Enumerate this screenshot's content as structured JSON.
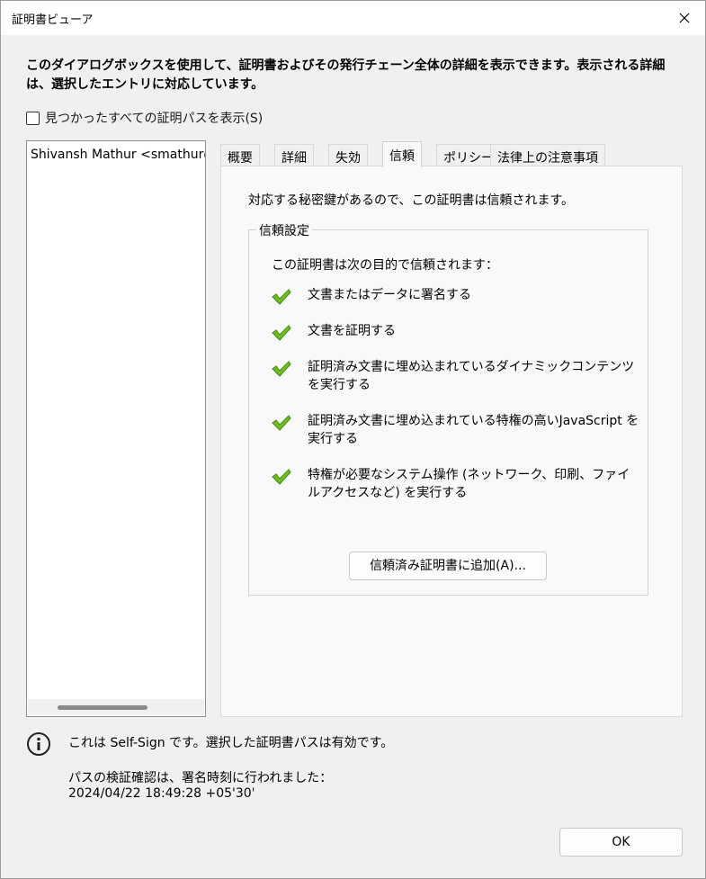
{
  "window": {
    "title": "証明書ビューア"
  },
  "intro_text": "このダイアログボックスを使用して、証明書およびその発行チェーン全体の詳細を表示できます。表示される詳細は、選択したエントリに対応しています。",
  "show_all_paths": {
    "label": "見つかったすべての証明パスを表示(S)",
    "checked": false
  },
  "tree": {
    "items": [
      {
        "label": "Shivansh Mathur <smathur@a"
      }
    ]
  },
  "tabs": [
    {
      "label": "概要",
      "active": false
    },
    {
      "label": "詳細",
      "active": false
    },
    {
      "label": "失効",
      "active": false
    },
    {
      "label": "信頼",
      "active": true
    },
    {
      "label": "ポリシー",
      "active": false
    },
    {
      "label": "法律上の注意事項",
      "active": false
    }
  ],
  "trust_tab": {
    "message": "対応する秘密鍵があるので、この証明書は信頼されます。",
    "group_label": "信頼設定",
    "group_intro": "この証明書は次の目的で信頼されます：",
    "permissions": [
      {
        "icon": "green-check-icon",
        "text": "文書またはデータに署名する"
      },
      {
        "icon": "green-check-icon",
        "text": "文書を証明する"
      },
      {
        "icon": "green-check-icon",
        "text": "証明済み文書に埋め込まれているダイナミックコンテンツを実行する"
      },
      {
        "icon": "green-check-icon",
        "text": "証明済み文書に埋め込まれている特権の高いJavaScript を実行する"
      },
      {
        "icon": "green-check-icon",
        "text": "特権が必要なシステム操作 (ネットワーク、印刷、ファイルアクセスなど) を実行する"
      }
    ],
    "add_button_label": "信頼済み証明書に追加(A)..."
  },
  "status": {
    "icon": "info-icon",
    "line1": "これは Self-Sign です。選択した証明書パスは有効です。",
    "line2": "パスの検証確認は、署名時刻に行われました：",
    "line3": "2024/04/22 18:49:28 +05'30'"
  },
  "ok_button_label": "OK",
  "colors": {
    "check_green": "#6fbf1f",
    "check_dark": "#3f8a12",
    "panel_bg": "#f9f9f9",
    "window_bg": "#f0f0f0"
  }
}
